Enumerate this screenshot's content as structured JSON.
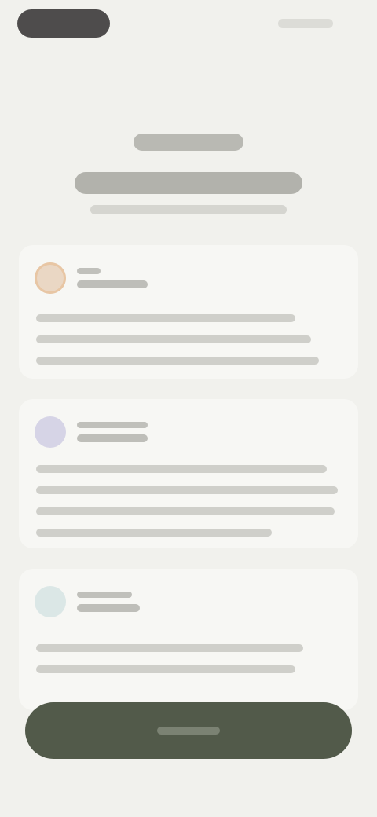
{
  "screen": {
    "background": "#f1f1ed",
    "accent": "#525a4a"
  },
  "header": {
    "eyebrow": "",
    "title": "",
    "subtitle": ""
  },
  "cards": [
    {
      "icon": "orange-circle-icon",
      "label": "",
      "title": "",
      "description": ""
    },
    {
      "icon": "purple-circle-icon",
      "label": "",
      "title": "",
      "description": ""
    },
    {
      "icon": "teal-circle-icon",
      "label": "",
      "title": "",
      "description": ""
    }
  ],
  "cta": {
    "label": ""
  }
}
